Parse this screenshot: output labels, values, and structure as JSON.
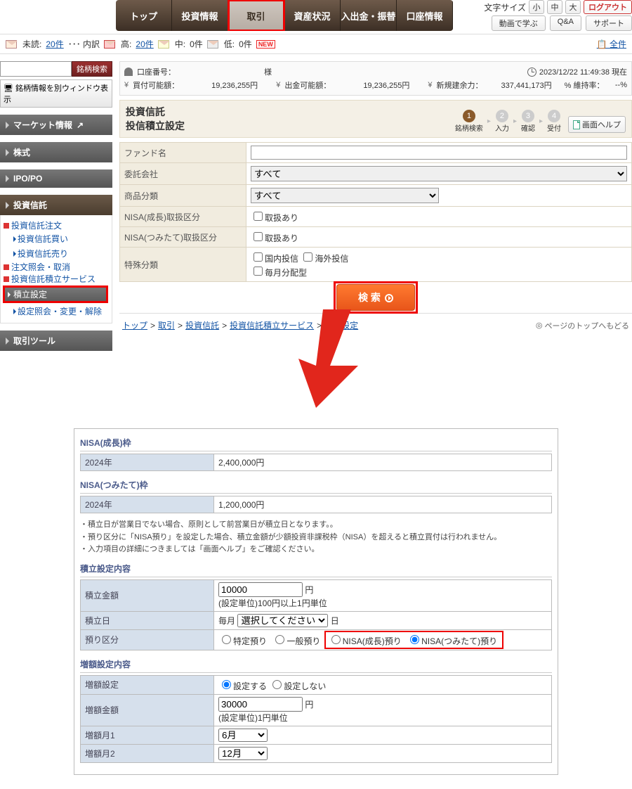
{
  "topbar": {
    "fontsize_label": "文字サイズ",
    "fs_small": "小",
    "fs_med": "中",
    "fs_large": "大",
    "logout": "ログアウト",
    "learn": "動画で学ぶ",
    "qa": "Q&A",
    "support": "サポート",
    "nav": [
      "トップ",
      "投資情報",
      "取引",
      "資産状況",
      "入出金・振替",
      "口座情報"
    ]
  },
  "unread": {
    "label": "未読:",
    "count": "20件",
    "breakdown": "･･･ 内訳",
    "hi_lbl": "高:",
    "hi": "20件",
    "mid_lbl": "中:",
    "mid": "0件",
    "lo_lbl": "低:",
    "lo": "0件",
    "new": "NEW",
    "all": "全件"
  },
  "side": {
    "search_btn": "銘柄検索",
    "newwin": "銘柄情報を別ウィンドウ表示",
    "market": "マーケット情報",
    "stocks": "株式",
    "ipo": "IPO/PO",
    "funds": "投資信託",
    "f_order": "投資信託注文",
    "f_buy": "投資信託買い",
    "f_sell": "投資信託売り",
    "orderq": "注文照会・取消",
    "serv": "投資信託積立サービス",
    "plan": "積立設定",
    "planq": "設定照会・変更・解除",
    "tools": "取引ツール"
  },
  "acct": {
    "no_lbl": "口座番号：",
    "sama": "様",
    "ts": "2023/12/22 11:49:38 現在",
    "buy_lbl": "買付可能額：",
    "buy": "19,236,255円",
    "wd_lbl": "出金可能額：",
    "wd": "19,236,255円",
    "mrg_lbl": "新規建余力：",
    "mrg": "337,441,173円",
    "maint_lbl": "% 維持率：",
    "maint": "--%"
  },
  "titles": {
    "cat": "投資信託",
    "page": "投信積立設定",
    "help": "画面ヘルプ"
  },
  "steps": {
    "s1": "銘柄検索",
    "s2": "入力",
    "s3": "確認",
    "s4": "受付"
  },
  "form": {
    "fund": "ファンド名",
    "company": "委託会社",
    "category": "商品分類",
    "nisa1": "NISA(成長)取扱区分",
    "nisa2": "NISA(つみたて)取扱区分",
    "special": "特殊分類",
    "all": "すべて",
    "avail": "取扱あり",
    "dom": "国内投信",
    "intl": "海外投信",
    "monthly": "毎月分配型",
    "search": "検 索"
  },
  "crumbs": {
    "c1": "トップ",
    "c2": "取引",
    "c3": "投資信託",
    "c4": "投資信託積立サービス",
    "c5": "積立設定",
    "top": "ページのトップへもどる"
  },
  "detail": {
    "g_hd": "NISA(成長)枠",
    "g_year": "2024年",
    "g_amt": "2,400,000円",
    "t_hd": "NISA(つみたて)枠",
    "t_year": "2024年",
    "t_amt": "1,200,000円",
    "note1": "・積立日が営業日でない場合、原則として前営業日が積立日となります。。",
    "note2": "・預り区分に「NISA預り」を設定した場合、積立金額が少額投資非課税枠（NISA）を超えると積立買付は行われません。",
    "note3": "・入力項目の詳細につきましては「画面ヘルプ」をご確認ください。",
    "sec1": "積立設定内容",
    "amt_lbl": "積立金額",
    "amt_val": "10000",
    "amt_unit": "円",
    "amt_note": "(設定単位)100円以上1円単位",
    "day_lbl": "積立日",
    "day_pre": "毎月",
    "day_sel": "選択してください",
    "day_suf": "日",
    "dep_lbl": "預り区分",
    "dep1": "特定預り",
    "dep2": "一般預り",
    "dep3": "NISA(成長)預り",
    "dep4": "NISA(つみたて)預り",
    "sec2": "増額設定内容",
    "inc_lbl": "増額設定",
    "inc_yes": "設定する",
    "inc_no": "設定しない",
    "inc_amt_lbl": "増額金額",
    "inc_amt_val": "30000",
    "inc_amt_note": "(設定単位)1円単位",
    "m1_lbl": "増額月1",
    "m1": "6月",
    "m2_lbl": "増額月2",
    "m2": "12月"
  }
}
